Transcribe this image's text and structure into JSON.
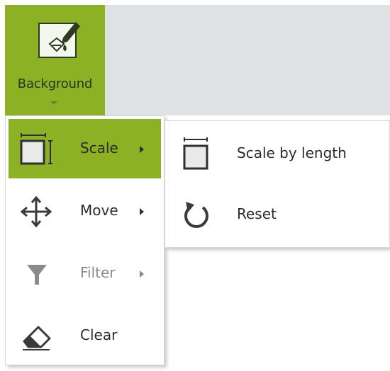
{
  "ribbon": {
    "background_button": {
      "label": "Background",
      "icon": "paint-bucket-pencil-icon",
      "active_color": "#8db125"
    }
  },
  "menu": {
    "items": [
      {
        "label": "Scale",
        "icon": "scale-box-icon",
        "has_submenu": true,
        "state": "active"
      },
      {
        "label": "Move",
        "icon": "move-arrows-icon",
        "has_submenu": true,
        "state": "normal"
      },
      {
        "label": "Filter",
        "icon": "funnel-icon",
        "has_submenu": true,
        "state": "disabled"
      },
      {
        "label": "Clear",
        "icon": "eraser-icon",
        "has_submenu": false,
        "state": "normal"
      }
    ]
  },
  "submenu": {
    "items": [
      {
        "label": "Scale by length",
        "icon": "scale-by-length-icon"
      },
      {
        "label": "Reset",
        "icon": "reset-arrow-icon"
      }
    ]
  },
  "colors": {
    "accent": "#8db125",
    "ribbon_bg": "#dfe2e4",
    "disabled_text": "#8a8a8a"
  }
}
